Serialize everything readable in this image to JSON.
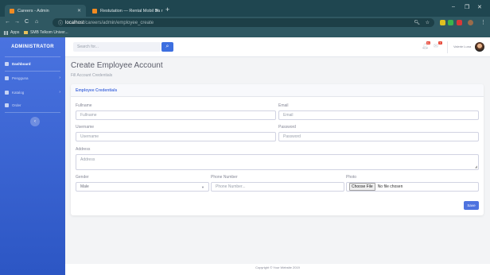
{
  "browser": {
    "tabs": [
      {
        "title": "Careers - Admin",
        "active": true
      },
      {
        "title": "Restutation — Rental Mobil Ba r",
        "active": false
      }
    ],
    "url_host": "localhost",
    "url_path": "/careers/admin/employee_create",
    "bookmarks": [
      {
        "label": "Apps"
      },
      {
        "label": "SMB Telkom Univer..."
      }
    ],
    "window_controls": {
      "minimize": "–",
      "maximize": "❐",
      "close": "✕"
    }
  },
  "sidebar": {
    "brand": "ADMINISTRATOR",
    "items": [
      {
        "label": "Dashboard",
        "icon": "dashboard-icon",
        "active": true,
        "has_caret": false
      },
      {
        "label": "Pengguna",
        "icon": "users-icon",
        "active": false,
        "has_caret": true
      },
      {
        "label": "Katalog",
        "icon": "catalog-icon",
        "active": false,
        "has_caret": true
      },
      {
        "label": "Order",
        "icon": "order-icon",
        "active": false,
        "has_caret": false
      }
    ],
    "toggle_icon": "‹"
  },
  "topbar": {
    "search_placeholder": "Search for...",
    "alerts_count": "3+",
    "messages_count": "7",
    "user_name": "Valerie Luna"
  },
  "page": {
    "title": "Create Employee Account",
    "subtitle": "Fill Account Credentials",
    "card_title": "Employee Credentials"
  },
  "form": {
    "fullname": {
      "label": "Fullname",
      "placeholder": "Fullname"
    },
    "email": {
      "label": "Email",
      "placeholder": "Email"
    },
    "username": {
      "label": "Username",
      "placeholder": "Username"
    },
    "password": {
      "label": "Password",
      "placeholder": "Password"
    },
    "address": {
      "label": "Address",
      "placeholder": "Address"
    },
    "gender": {
      "label": "Gender",
      "value": "Male"
    },
    "phone": {
      "label": "Phone Number",
      "placeholder": "Phone Number..."
    },
    "photo": {
      "label": "Photo",
      "button": "Choose File",
      "status": "No file chosen"
    },
    "save_label": "Save"
  },
  "footer": {
    "text": "Copyright © Your Website 2019"
  },
  "colors": {
    "primary": "#4e73df",
    "sidebar_top": "#4a73e0",
    "chrome": "#1f4650"
  }
}
